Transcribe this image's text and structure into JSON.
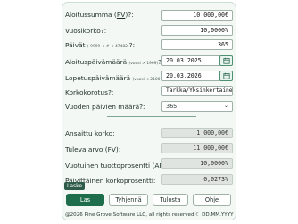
{
  "fields": {
    "principal": {
      "label_prefix": "Aloitussumma (",
      "label_link": "PV",
      "label_suffix": ")?:",
      "value": "10 000,00€"
    },
    "annual_rate": {
      "label": "Vuosikorko?:",
      "value": "10,0000%"
    },
    "days": {
      "label": "Päivät",
      "hint": "(-9999 < # < 47482)",
      "label_suffix": "?:",
      "value": "365"
    },
    "start_date": {
      "label": "Aloituspäivämäärä",
      "hint": "(vuosi > 1969)",
      "label_suffix": "?:",
      "value": "20.03.2025"
    },
    "end_date": {
      "label": "Lopetuspäivämäärä",
      "hint": "(vuosi < 2100)",
      "label_suffix": "?:",
      "value": "20.03.2026"
    },
    "compounding": {
      "label": "Korkokorotus?:",
      "value": "Tarkka/Yksinkertaine"
    },
    "year_days": {
      "label": "Vuoden päivien määrä?:",
      "value": "365"
    }
  },
  "results": {
    "interest_earned": {
      "label": "Ansaittu korko:",
      "value": "1 000,00€"
    },
    "future_value": {
      "label": "Tuleva arvo (FV):",
      "value": "11 000,00€"
    },
    "apy": {
      "label": "Vuotuinen tuottoprosentti (APY):",
      "value": "10,0000%"
    },
    "daily_rate": {
      "label": "Päivittäinen korkoprosentti:",
      "value": "0,0273%"
    }
  },
  "tooltip": "Laske",
  "buttons": {
    "calc": "Las",
    "clear": "Tyhjennä",
    "print": "Tulosta",
    "help": "Ohje"
  },
  "footer": "@2026 Pine Grove Software LLC, all rights reserved  ☾  DD.MM.YYYY",
  "icons": {
    "calendar": "calendar-icon",
    "dropdown": "chevron-down-icon"
  },
  "colors": {
    "accent": "#1e6d4b",
    "panel": "#f3f8f5",
    "readonly": "#dfe4e1"
  }
}
